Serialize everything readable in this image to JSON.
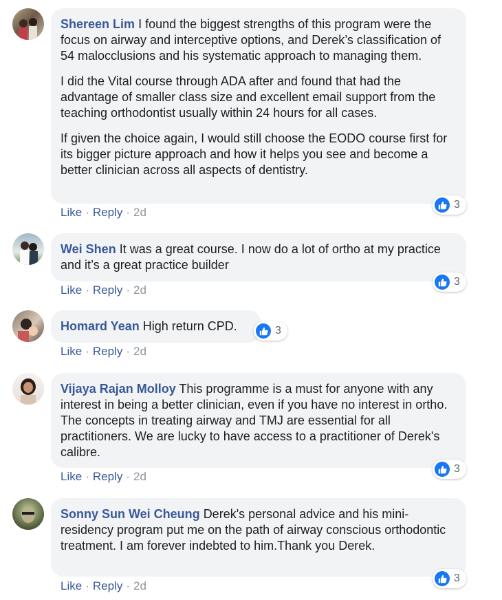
{
  "comments": [
    {
      "author": "Shereen Lim",
      "paragraphs": [
        "I found the biggest strengths of this program were the focus on airway and interceptive options, and Derek’s classification of 54 malocclusions and his systematic approach to managing them.",
        "I did the Vital course through ADA after and found that had the advantage of smaller class size and excellent email support from the teaching orthodontist usually within 24 hours for all cases.",
        "If given the choice again, I would still choose the EODO course first for its bigger picture approach and how it helps you see and become a better clinician across all aspects of dentistry."
      ],
      "reactions": "3",
      "like": "Like",
      "reply": "Reply",
      "time": "2d"
    },
    {
      "author": "Wei Shen",
      "paragraphs": [
        "It was a great course. I now do a lot of ortho at my practice and it’s a great practice builder"
      ],
      "reactions": "3",
      "like": "Like",
      "reply": "Reply",
      "time": "2d"
    },
    {
      "author": "Homard Yean",
      "paragraphs": [
        "High return CPD."
      ],
      "reactions": "3",
      "like": "Like",
      "reply": "Reply",
      "time": "2d"
    },
    {
      "author": "Vijaya Rajan Molloy",
      "paragraphs": [
        "This programme is a must for anyone with any interest in being a better clinician, even if you have no interest in ortho. The concepts in treating airway and TMJ are essential for all practitioners. We are lucky to have access to a practitioner of Derek's calibre."
      ],
      "reactions": "3",
      "like": "Like",
      "reply": "Reply",
      "time": "2d"
    },
    {
      "author": "Sonny Sun Wei Cheung",
      "paragraphs": [
        "Derek's personal advice and his mini-residency program put me on the path of airway conscious orthodontic treatment. I am forever indebted to him.Thank you Derek."
      ],
      "reactions": "3",
      "like": "Like",
      "reply": "Reply",
      "time": "2d"
    }
  ],
  "colors": {
    "author": "#385898",
    "bubble": "#f2f3f5",
    "like_blue": "#1877f2",
    "meta_gray": "#90949c"
  },
  "icons": {
    "reaction": "thumbs-up-icon",
    "separator": "·"
  }
}
